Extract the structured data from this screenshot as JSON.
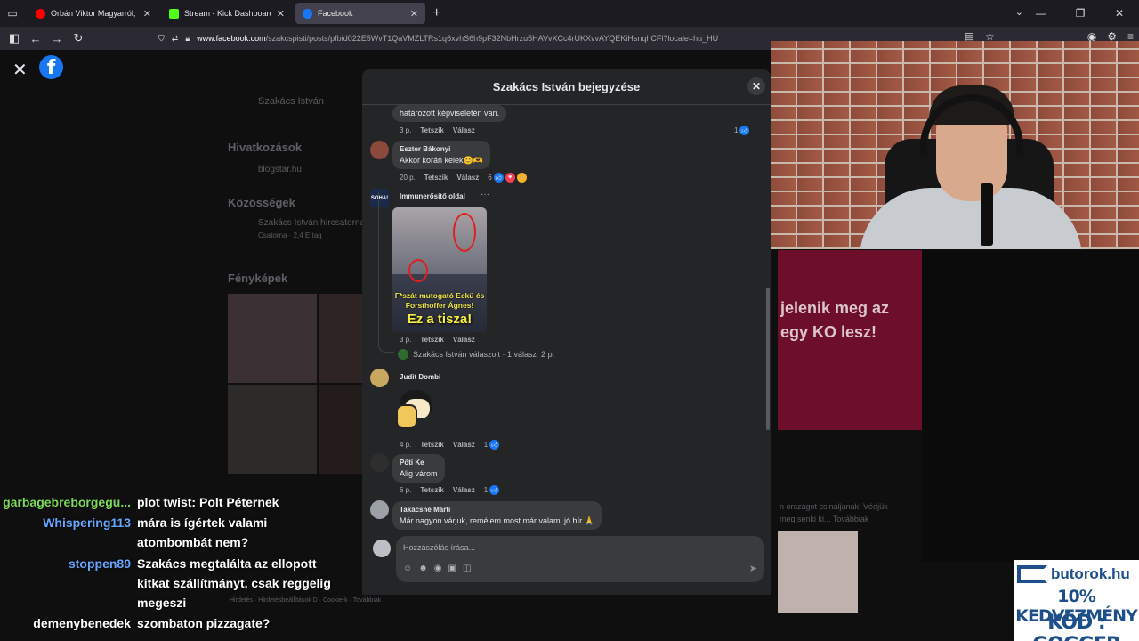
{
  "browser": {
    "tabs": [
      {
        "title": "Orbán Viktor Magyarról, Wáber",
        "icon_color": "#ff0000"
      },
      {
        "title": "Stream - Kick Dashboard",
        "icon_color": "#53fc18"
      },
      {
        "title": "Facebook",
        "icon_color": "#1877f2"
      }
    ],
    "new_tab": "+",
    "url_host": "www.facebook.com",
    "url_path": "/szakcspisti/posts/pfbid022E5WvT1QaVMZLTRs1q6xvhS6h9pF32NbHrzu5HAVvXCc4rUKXvvAYQEKiHsnqhCFl?locale=hu_HU"
  },
  "fb_background": {
    "page_name": "Szakács István",
    "links_heading": "Hivatkozások",
    "link": "blogstar.hu",
    "communities_heading": "Közösségek",
    "community_name": "Szakács István hírcsatorna",
    "community_meta": "Csatorna · 2,4 E tag",
    "photos_heading": "Fényképek",
    "footer": "Hirdetés · Hirdetésbeállítások D · Cookie-k · Továbbiak",
    "right_text_1": "n országot csinaljanak! Védjük",
    "right_text_2": "meg senki ki... Továbbiak"
  },
  "modal": {
    "title": "Szakács István bejegyzése",
    "comments": [
      {
        "text": "határozott képviseletén van.",
        "time": "3 p.",
        "like": "Tetszik",
        "reply": "Válasz",
        "reactions": "1"
      },
      {
        "name": "Eszter Bákonyi",
        "text": "Akkor korán kelek😊🫶",
        "time": "20 p.",
        "like": "Tetszik",
        "reply": "Válasz",
        "reactions": "6"
      },
      {
        "name": "Immunerősítő oldal",
        "avatar_text": "SOHA!",
        "img_caption_1": "F*szát mutogató Eckü és Forsthoffer Ágnes!",
        "img_caption_2": "Ez a tisza!",
        "time": "3 p.",
        "like": "Tetszik",
        "reply": "Válasz",
        "replied_by": "Szakács István válaszolt · 1 válasz",
        "replied_time": "2 p."
      },
      {
        "name": "Judit Dombi",
        "time": "4 p.",
        "like": "Tetszik",
        "reply": "Válasz",
        "reactions": "1"
      },
      {
        "name": "Pöti Ke",
        "text": "Alig várom",
        "time": "6 p.",
        "like": "Tetszik",
        "reply": "Válasz",
        "reactions": "1"
      },
      {
        "name": "Takácsné Márti",
        "text": "Már nagyon várjuk, remélem most már valami jó hír 🙏"
      }
    ],
    "composer_placeholder": "Hozzászólás írása..."
  },
  "overlay": {
    "red_panel_line_1": "jelenik meg az",
    "red_panel_line_2": "egy KO lesz!"
  },
  "chat": [
    {
      "user": "garbagebreborgegu...",
      "message": "plot twist: Polt Péternek",
      "color": "#7cd957"
    },
    {
      "user": "Whispering113",
      "message": "mára is ígértek valami atombombát nem?",
      "color": "#67a7ff"
    },
    {
      "user": "stoppen89",
      "message": "Szakács megtalálta az ellopott kitkat szállítmányt, csak reggelig megeszi",
      "color": "#67a7ff"
    },
    {
      "user": "demenybenedek",
      "message": "szombaton pizzagate?",
      "color": "#ffffff"
    }
  ],
  "sponsor": {
    "brand": "butorok.hu",
    "line1": "10% KEDVEZMÉNY",
    "line2": "KÓD : GOGGER"
  }
}
